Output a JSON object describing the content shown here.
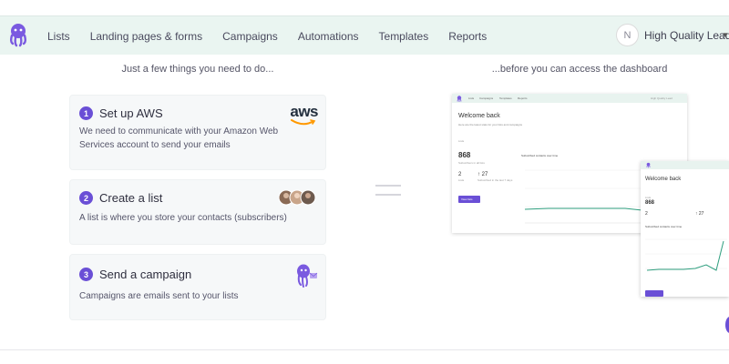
{
  "nav": {
    "items": [
      "Lists",
      "Landing pages & forms",
      "Campaigns",
      "Automations",
      "Templates",
      "Reports"
    ],
    "avatar_initial": "N",
    "account_name": "High Quality Lead"
  },
  "headings": {
    "left": "Just a few things you need to do...",
    "right": "...before you can access the dashboard"
  },
  "steps": [
    {
      "number": "1",
      "title": "Set up AWS",
      "description": "We need to communicate with your Amazon Web Services account to send your emails",
      "icon": "aws-logo-icon",
      "icon_text": "aws"
    },
    {
      "number": "2",
      "title": "Create a list",
      "description": "A list is where you store your contacts (subscribers)",
      "icon": "people-faces-icon"
    },
    {
      "number": "3",
      "title": "Send a campaign",
      "description": "Campaigns are emails sent to your lists",
      "icon": "octopus-mascot-icon"
    }
  ],
  "preview": {
    "nav_items": [
      "Lists",
      "Campaigns",
      "Templates",
      "Reports"
    ],
    "welcome": "Welcome back",
    "subtitle": "Here are the latest stats for your lists and campaigns",
    "section": "Lists",
    "big_number": "868",
    "big_label": "Subscribers in all lists",
    "stat_a": "2",
    "stat_a_label": "Lists",
    "stat_b": "↑ 27",
    "stat_b_label": "Subscribed in the last 7 days",
    "chart_title": "Subscribed contacts over time",
    "button": "View lists",
    "range": "Last 7 days"
  },
  "colors": {
    "accent": "#6a4fd6",
    "topbar": "#eaf5f1",
    "card": "#f6f8f9"
  }
}
